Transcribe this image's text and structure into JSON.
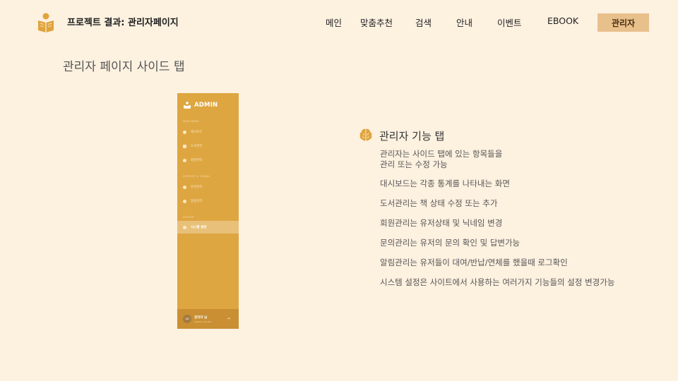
{
  "header": {
    "brand": "프로젝트 결과: 관리자페이지",
    "nav": [
      "메인",
      "맞춤추천",
      "검색",
      "안내",
      "이벤트",
      "EBOOK"
    ],
    "admin_button": "관리자"
  },
  "section_title": "관리자 페이지 사이드 탭",
  "sidebar": {
    "title": "ADMIN",
    "sections": [
      "MAIN MENU",
      "SUPPORT & SIGNAL",
      "SYSTEM"
    ],
    "items": [
      "대시보드",
      "도서관리",
      "회원관리",
      "문의관리",
      "알림관리",
      "시스템 설정"
    ],
    "user": {
      "avatar": "AD",
      "name": "관리자 님",
      "role": "system operator",
      "logout": "⇥"
    }
  },
  "feature": {
    "title": "관리자 기능 탭",
    "intro": [
      "관리자는 사이드 탭에 있는 항목들을",
      "관리 또는 수정 가능"
    ],
    "lines": [
      "대시보드는 각종 통계를 나타내는 화면",
      "도서관리는 책 상태 수정 또는 추가",
      "회원관리는 유저상태 및 닉네임 변경",
      "문의관리는 유저의 문의 확인 및 답변가능",
      "알림관리는 유저들이 대여/반납/연체를 했을때 로그확인",
      "시스템 설정은 사이트에서 사용하는 여러가지 기능들의 설정 변경가능"
    ]
  },
  "colors": {
    "background": "#fdf1e0",
    "accent": "#dea641",
    "admin_button": "#e8c08c"
  }
}
